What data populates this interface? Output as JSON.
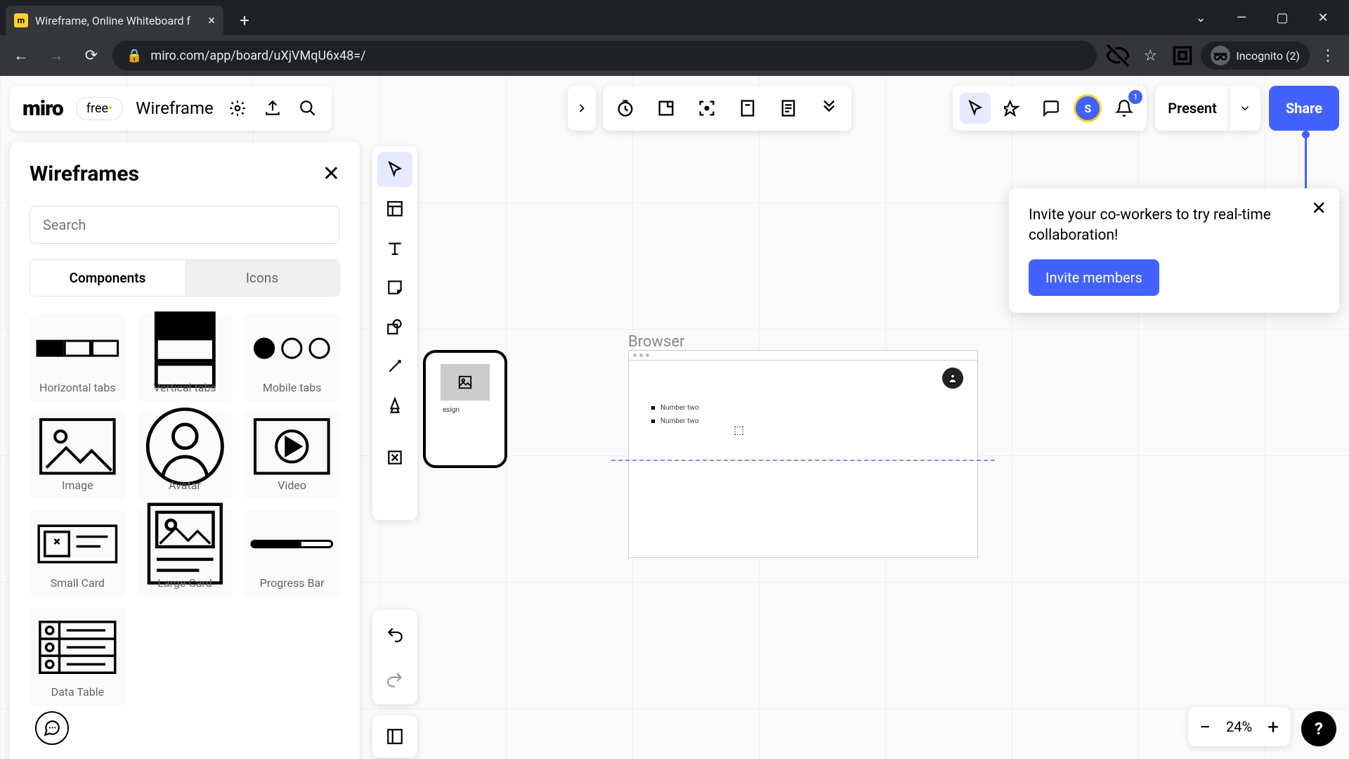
{
  "browser": {
    "tab_title": "Wireframe, Online Whiteboard f",
    "url": "miro.com/app/board/uXjVMqU6x48=/",
    "incognito_label": "Incognito (2)"
  },
  "app_header": {
    "logo": "miro",
    "plan": "free",
    "board_name": "Wireframe"
  },
  "left_panel": {
    "title": "Wireframes",
    "search_placeholder": "Search",
    "tabs": {
      "components": "Components",
      "icons": "Icons"
    },
    "items": [
      "Horizontal tabs",
      "Vertical tabs",
      "Mobile tabs",
      "Image",
      "Avatar",
      "Video",
      "Small Card",
      "Large Card",
      "Progress Bar",
      "Data Table"
    ]
  },
  "canvas": {
    "browser_label": "Browser",
    "mobile_caption": "esign",
    "list_item": "Number two"
  },
  "top_right": {
    "user_initial": "S",
    "notif_count": "1",
    "present": "Present",
    "share": "Share"
  },
  "invite": {
    "text": "Invite your co-workers to try real-time collaboration!",
    "button": "Invite members"
  },
  "zoom": {
    "value": "24%"
  }
}
